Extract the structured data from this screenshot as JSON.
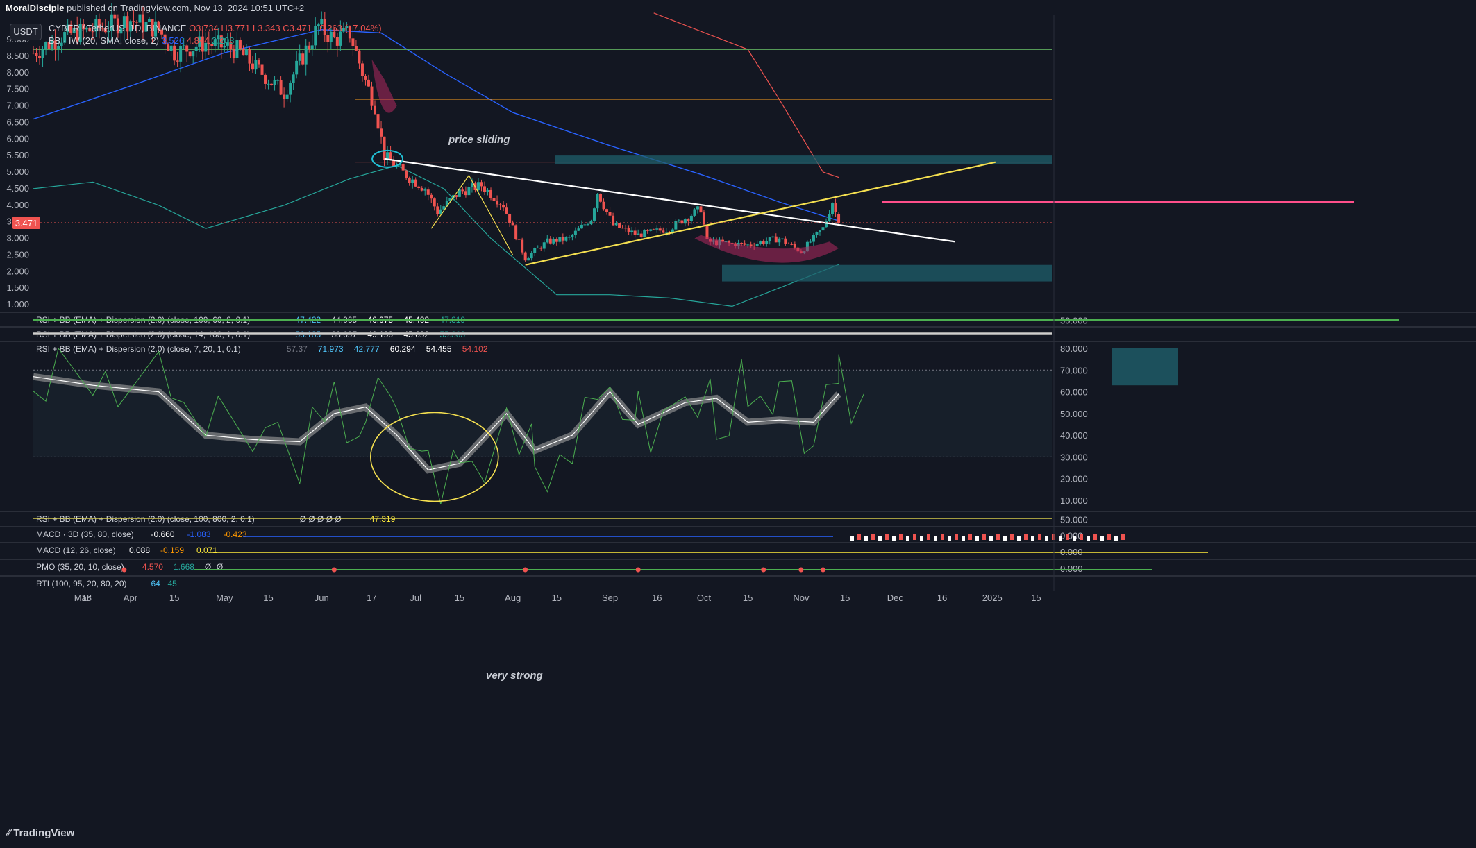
{
  "header": {
    "publisher": "MoralDisciple",
    "published_text": "published on TradingView.com, Nov 13, 2024 10:51 UTC+2"
  },
  "symbol_button": "USDT",
  "legend": {
    "symbol": "CYBER / TetherUS, 1D, BINANCE",
    "ohlc": "O3.734  H3.771  L3.343  C3.471  −0.263 (−7.04%)",
    "bb": "BB · IW (20, SMA, close, 2)",
    "bb_vals": [
      "3.526",
      "4.844",
      "2.208"
    ]
  },
  "last_price": "3.471",
  "price_axis": [
    "9.000",
    "8.500",
    "8.000",
    "7.500",
    "7.000",
    "6.500",
    "6.000",
    "5.500",
    "5.000",
    "4.500",
    "4.000",
    "3.500",
    "3.000",
    "2.500",
    "2.000",
    "1.500",
    "1.000"
  ],
  "time_axis": [
    "Mar",
    "18",
    "Apr",
    "15",
    "May",
    "15",
    "Jun",
    "17",
    "Jul",
    "15",
    "Aug",
    "15",
    "Sep",
    "16",
    "Oct",
    "15",
    "Nov",
    "15",
    "Dec",
    "16",
    "2025",
    "15"
  ],
  "annotations": {
    "price_sliding": "price sliding",
    "very_strong": "very strong"
  },
  "panes": {
    "rsi100": {
      "label": "RSI + BB (EMA) + Dispersion (2.0) (close, 100, 60, 2, 0.1)",
      "vals": [
        "47.422",
        "44.065",
        "46.075",
        "45.402",
        "47.319"
      ],
      "scale": "50.000"
    },
    "rsi14": {
      "label": "RSI + BB (EMA) + Dispersion (2.0) (close, 14, 100, 1, 0.1)",
      "vals": [
        "56.185",
        "38.697",
        "49.190",
        "45.692",
        "55.303"
      ]
    },
    "rsi7": {
      "label": "RSI + BB (EMA) + Dispersion (2.0) (close, 7, 20, 1, 0.1)",
      "vals": [
        "57.37",
        "71.973",
        "42.777",
        "60.294",
        "54.455",
        "54.102"
      ],
      "scale": [
        "80.000",
        "70.000",
        "60.000",
        "50.000",
        "40.000",
        "30.000",
        "20.000",
        "10.000"
      ]
    },
    "rsi800": {
      "label": "RSI + BB (EMA) + Dispersion (2.0) (close, 100, 800, 2, 0.1)",
      "vals": "Ø  Ø  Ø  Ø  Ø",
      "last": "47.319",
      "scale": "50.000"
    },
    "macd3d": {
      "label": "MACD · 3D (35, 80, close)",
      "vals": [
        "-0.660",
        "-1.083",
        "-0.423"
      ],
      "scale": "0.000"
    },
    "macd": {
      "label": "MACD (12, 26, close)",
      "vals": [
        "0.088",
        "-0.159",
        "0.071"
      ],
      "scale": "0.000"
    },
    "pmo": {
      "label": "PMO (35, 20, 10, close)",
      "vals": [
        "4.570",
        "1.668",
        "Ø",
        "Ø"
      ],
      "scale": "0.000"
    },
    "rti": {
      "label": "RTI (100, 95, 20, 80, 20)",
      "vals": [
        "64",
        "45"
      ]
    }
  },
  "brand": "TradingView",
  "colors": {
    "bg": "#131722",
    "up": "#26a69a",
    "down": "#ef5350",
    "grid": "#2a2e39",
    "trend_white": "#ffffff",
    "trend_yellow": "#f5e050",
    "pink": "#ff4f8b",
    "zone": "#1f5f6b"
  },
  "chart_data": {
    "type": "candlestick",
    "symbol": "CYBER / TetherUS",
    "timeframe": "1D",
    "exchange": "BINANCE",
    "x_range": [
      "2024-03-01",
      "2025-01-20"
    ],
    "ylim": [
      0.8,
      9.6
    ],
    "ohlc_last": {
      "open": 3.734,
      "high": 3.771,
      "low": 3.343,
      "close": 3.471,
      "change": -0.263,
      "change_pct": -7.04
    },
    "bollinger_last": {
      "basis": 3.526,
      "upper": 4.844,
      "lower": 2.208
    },
    "close_path": [
      {
        "date": "2024-03-01",
        "close": 8.6
      },
      {
        "date": "2024-03-10",
        "close": 9.1
      },
      {
        "date": "2024-03-20",
        "close": 9.3
      },
      {
        "date": "2024-04-01",
        "close": 9.6
      },
      {
        "date": "2024-04-10",
        "close": 9.3
      },
      {
        "date": "2024-04-15",
        "close": 8.6
      },
      {
        "date": "2024-04-25",
        "close": 8.9
      },
      {
        "date": "2024-05-05",
        "close": 8.7
      },
      {
        "date": "2024-05-15",
        "close": 7.8
      },
      {
        "date": "2024-05-20",
        "close": 7.4
      },
      {
        "date": "2024-05-26",
        "close": 8.5
      },
      {
        "date": "2024-05-31",
        "close": 9.4
      },
      {
        "date": "2024-06-05",
        "close": 9.0
      },
      {
        "date": "2024-06-10",
        "close": 9.2
      },
      {
        "date": "2024-06-14",
        "close": 8.0
      },
      {
        "date": "2024-06-18",
        "close": 7.0
      },
      {
        "date": "2024-06-21",
        "close": 5.5
      },
      {
        "date": "2024-06-28",
        "close": 4.9
      },
      {
        "date": "2024-07-04",
        "close": 4.5
      },
      {
        "date": "2024-07-08",
        "close": 3.8
      },
      {
        "date": "2024-07-15",
        "close": 4.4
      },
      {
        "date": "2024-07-22",
        "close": 4.6
      },
      {
        "date": "2024-07-29",
        "close": 4.0
      },
      {
        "date": "2024-08-05",
        "close": 2.4
      },
      {
        "date": "2024-08-12",
        "close": 2.9
      },
      {
        "date": "2024-08-19",
        "close": 3.0
      },
      {
        "date": "2024-08-26",
        "close": 3.6
      },
      {
        "date": "2024-08-28",
        "close": 4.4
      },
      {
        "date": "2024-09-02",
        "close": 3.4
      },
      {
        "date": "2024-09-10",
        "close": 3.1
      },
      {
        "date": "2024-09-20",
        "close": 3.3
      },
      {
        "date": "2024-09-30",
        "close": 3.9
      },
      {
        "date": "2024-10-02",
        "close": 2.9
      },
      {
        "date": "2024-10-15",
        "close": 2.8
      },
      {
        "date": "2024-10-25",
        "close": 3.0
      },
      {
        "date": "2024-11-01",
        "close": 2.6
      },
      {
        "date": "2024-11-08",
        "close": 3.3
      },
      {
        "date": "2024-11-11",
        "close": 4.1
      },
      {
        "date": "2024-11-13",
        "close": 3.471
      }
    ],
    "horizontal_levels": [
      8.7,
      7.2,
      5.3,
      4.1
    ],
    "zones": [
      {
        "from": 5.25,
        "to": 5.5
      },
      {
        "from": 1.7,
        "to": 2.2
      }
    ],
    "trendlines": [
      {
        "name": "descending",
        "from": {
          "date": "2024-06-21",
          "price": 5.4
        },
        "to": {
          "date": "2024-12-20",
          "price": 2.9
        }
      },
      {
        "name": "ascending",
        "from": {
          "date": "2024-08-05",
          "price": 2.2
        },
        "to": {
          "date": "2025-01-02",
          "price": 5.3
        }
      }
    ]
  }
}
